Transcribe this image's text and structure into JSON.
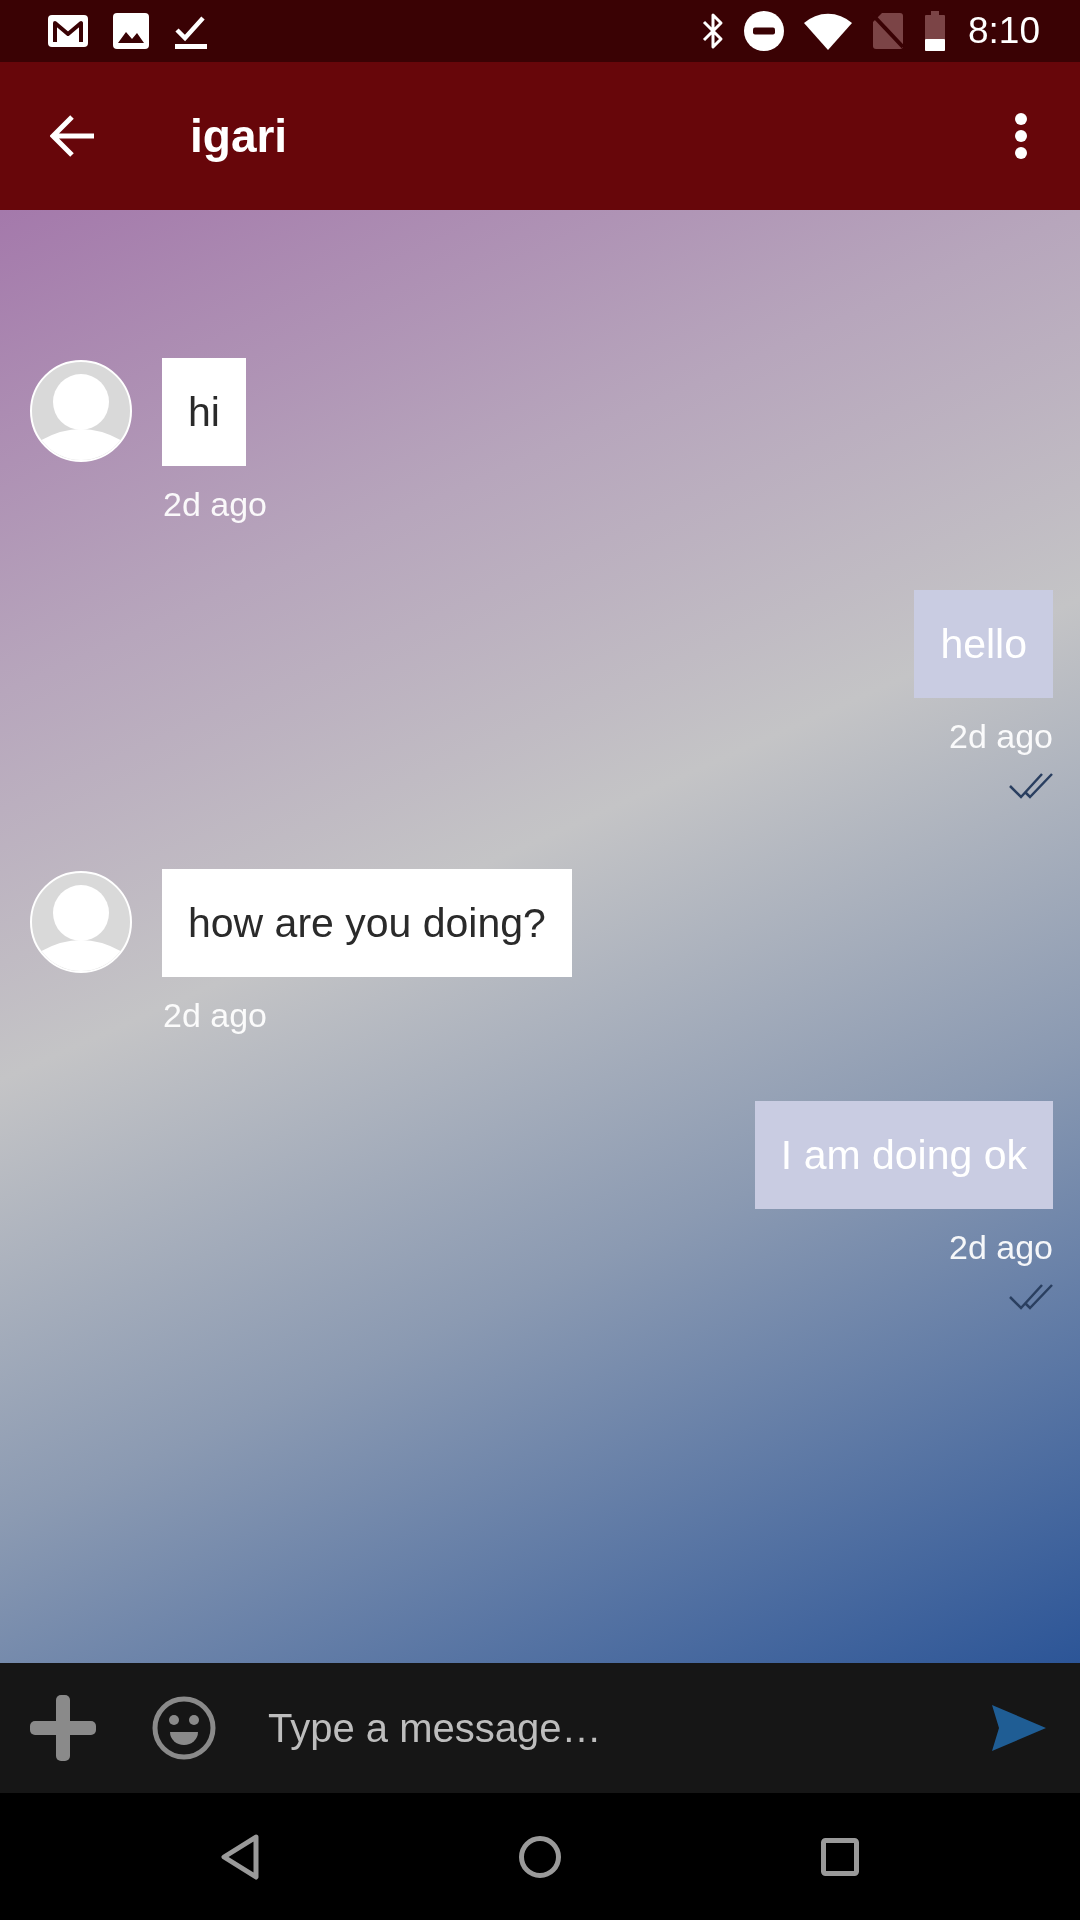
{
  "status_bar": {
    "time": "8:10"
  },
  "app_bar": {
    "title": "igari"
  },
  "messages": [
    {
      "kind": "incoming",
      "text": "hi",
      "time": "2d ago"
    },
    {
      "kind": "outgoing",
      "text": "hello",
      "time": "2d ago",
      "read": true
    },
    {
      "kind": "incoming",
      "text": "how are you doing?",
      "time": "2d ago"
    },
    {
      "kind": "outgoing",
      "text": "I am doing ok",
      "time": "2d ago",
      "read": true
    }
  ],
  "composer": {
    "placeholder": "Type a message…"
  }
}
